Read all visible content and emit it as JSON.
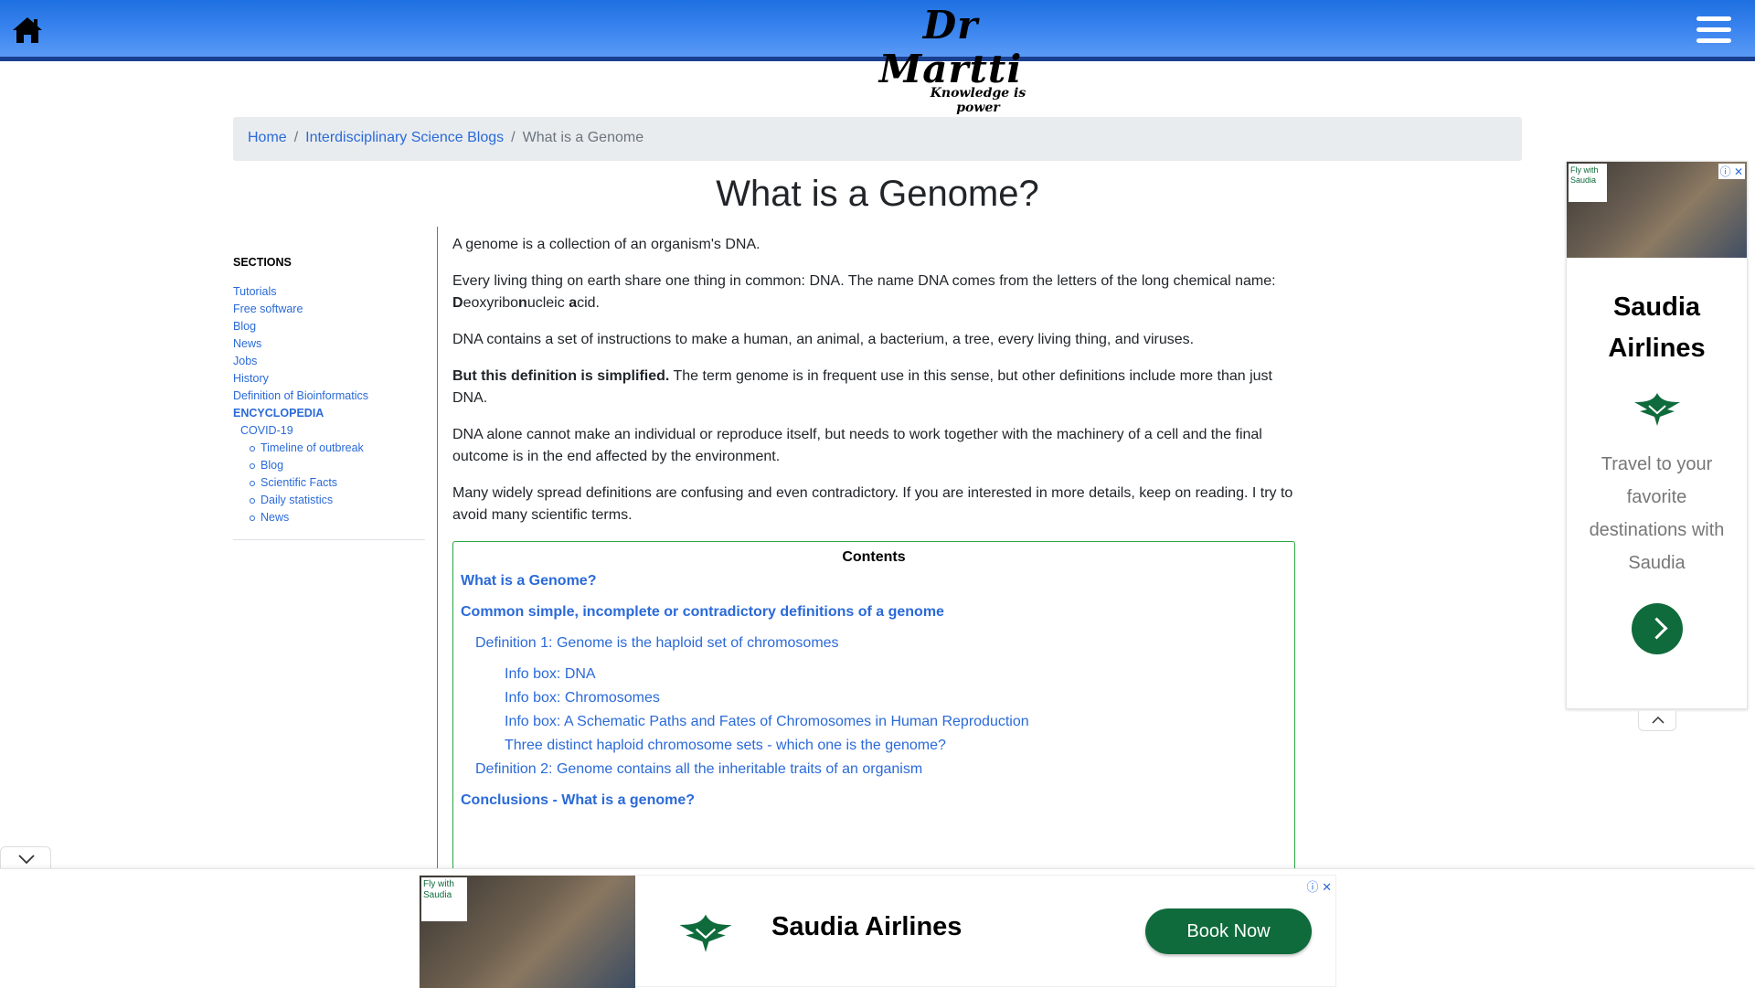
{
  "header": {
    "logo_name": "Dr Martti",
    "logo_tagline": "Knowledge is power"
  },
  "breadcrumb": {
    "home": "Home",
    "section": "Interdisciplinary Science Blogs",
    "current": "What is a Genome"
  },
  "page_title": "What is a Genome?",
  "sidebar": {
    "heading": "SECTIONS",
    "items": [
      "Tutorials",
      "Free software",
      "Blog",
      "News",
      "Jobs",
      "History",
      "Definition of Bioinformatics"
    ],
    "encyclopedia": "ENCYCLOPEDIA",
    "covid": "COVID-19",
    "covid_items": [
      "Timeline of outbreak",
      "Blog",
      "Scientific Facts",
      "Daily statistics",
      "News"
    ]
  },
  "content": {
    "p1": "A genome is a collection of an organism's DNA.",
    "p2_a": "Every living thing on earth share one thing in common: DNA. The name DNA comes from the letters of the long chemical name: ",
    "p2_d": "D",
    "p2_e": "eoxyribo",
    "p2_n": "n",
    "p2_u": "ucleic ",
    "p2_ac": "a",
    "p2_cid": "cid.",
    "p3": "DNA contains a set of instructions to make a human, an animal, a bacterium, a tree, every living thing, and viruses.",
    "p4_bold": "But this definition is simplified.",
    "p4_rest": " The term genome is in frequent use in this sense, but other definitions include more than just DNA.",
    "p5": "DNA alone cannot make an individual or reproduce itself, but needs to work together with the machinery of a cell and the final outcome is in the end affected by the environment.",
    "p6": "Many widely spread definitions are confusing and even contradictory. If you are interested in more details, keep on reading. I try to avoid many scientific terms."
  },
  "toc": {
    "title": "Contents",
    "l1_a": "What is a Genome?",
    "l1_b": "Common simple, incomplete or contradictory definitions of a genome",
    "def1": "Definition 1: Genome is the haploid set of chromosomes",
    "info_dna": "Info box: DNA",
    "info_chrom": "Info box: Chromosomes",
    "info_schematic": "Info box: A Schematic Paths and Fates of Chromosomes in Human Reproduction",
    "three_sets": "Three distinct haploid chromosome sets - which one is the genome?",
    "def2": "Definition 2: Genome contains all the inheritable traits of an organism",
    "conclusions": "Conclusions - What is a genome?"
  },
  "side_ad": {
    "tag": "Fly with Saudia",
    "brand": "Saudia Airlines",
    "tagline": "Travel to your favorite destinations with Saudia",
    "accent": "#0f6b3b"
  },
  "bottom_ad": {
    "tag": "Fly with Saudia",
    "brand": "Saudia Airlines",
    "button": "Book Now"
  },
  "colors": {
    "link": "#2a6ad8",
    "header_blue": "#2b7bea",
    "toc_border": "#28a745"
  }
}
